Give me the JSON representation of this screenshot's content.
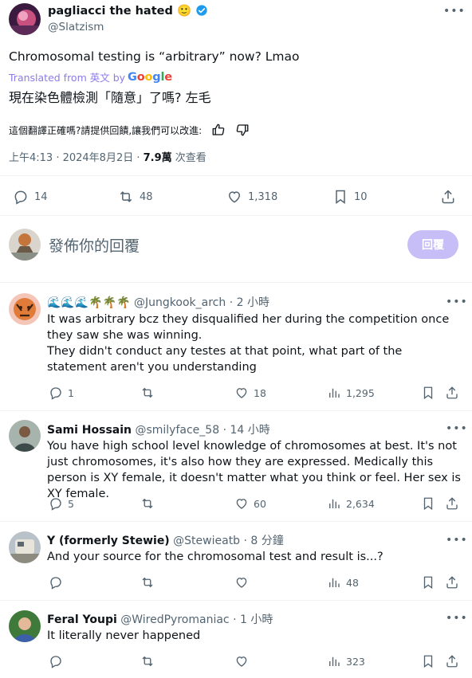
{
  "tweet": {
    "author_name": "pagliacci the hated",
    "author_emoji": "🙂",
    "handle": "@Slatzism",
    "text": "Chromosomal testing is “arbitrary” now? Lmao",
    "translated_prefix": "Translated from 英文 by",
    "translated_brand": "Google",
    "translation": "現在染色體檢測「隨意」了嗎? 左毛",
    "feedback_prompt": "這個翻譯正確嗎?請提供回饋,讓我們可以改進:",
    "time": "上午4:13 · 2024年8月2日 · ",
    "views_count": "7.9萬",
    "views_label": " 次查看",
    "stats": {
      "replies": "14",
      "retweets": "48",
      "likes": "1,318",
      "bookmarks": "10"
    }
  },
  "composer": {
    "placeholder": "發佈你的回覆",
    "button_label": "回覆"
  },
  "replies": [
    {
      "name": "🌊🌊🌊🌴🌴🌴",
      "handle": "@Jungkook_arch",
      "time": "· 2 小時",
      "lines": [
        "It was arbitrary bcz they disqualified her during the competition once they saw she was winning.",
        "They didn't conduct any testes at that point, what part of the statement aren't you understanding"
      ],
      "replies": "1",
      "retweets": "",
      "likes": "18",
      "views": "1,295"
    },
    {
      "name": "Sami Hossain",
      "handle": "@smilyface_58",
      "time": "· 14 小時",
      "lines": [
        "You have high school level knowledge of chromosomes at best. It's not just chromosomes, it's also how they are expressed. Medically this person is XY female, it doesn't matter what you think or feel. Her sex is XY female."
      ],
      "replies": "5",
      "retweets": "",
      "likes": "60",
      "views": "2,634"
    },
    {
      "name": "Y (formerly Stewie)",
      "handle": "@Stewieatb",
      "time": "· 8 分鐘",
      "lines": [
        "And your source for the chromosomal test and result is...?"
      ],
      "replies": "",
      "retweets": "",
      "likes": "",
      "views": "48"
    },
    {
      "name": "Feral Youpi",
      "handle": "@WiredPyromaniac",
      "time": "· 1 小時",
      "lines": [
        "It literally never happened"
      ],
      "replies": "",
      "retweets": "",
      "likes": "",
      "views": "323"
    }
  ],
  "colors": {
    "verified": "#1d9bf0",
    "translated_link": "#8c7be8",
    "reply_button": "#c8bef7",
    "muted_text": "#536471",
    "divider": "#eff3f4"
  },
  "icons": [
    "verified-badge-icon",
    "more-icon",
    "reply-icon",
    "retweet-icon",
    "like-icon",
    "bookmark-icon",
    "share-icon",
    "views-icon",
    "thumbs-up-icon",
    "thumbs-down-icon"
  ]
}
